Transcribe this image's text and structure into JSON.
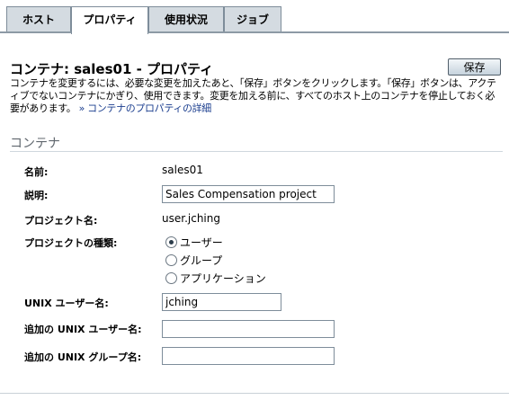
{
  "tabs": [
    {
      "label": "ホスト",
      "active": false
    },
    {
      "label": "プロパティ",
      "active": true
    },
    {
      "label": "使用状況",
      "active": false
    },
    {
      "label": "ジョブ",
      "active": false
    }
  ],
  "page": {
    "title": "コンテナ: sales01 - プロパティ",
    "save_label": "保存",
    "description": "コンテナを変更するには、必要な変更を加えたあと、「保存」ボタンをクリックします。「保存」ボタンは、アクティブでないコンテナにかぎり、使用できます。変更を加える前に、すべてのホスト上のコンテナを停止しておく必要があります。",
    "details_link": "» コンテナのプロパティの詳細"
  },
  "section": {
    "title": "コンテナ"
  },
  "form": {
    "name_label": "名前:",
    "name_value": "sales01",
    "desc_label": "説明:",
    "desc_value": "Sales Compensation project",
    "project_label": "プロジェクト名:",
    "project_value": "user.jching",
    "type_label": "プロジェクトの種類:",
    "type_options": [
      {
        "label": "ユーザー",
        "checked": true
      },
      {
        "label": "グループ",
        "checked": false
      },
      {
        "label": "アプリケーション",
        "checked": false
      }
    ],
    "unix_user_label": "UNIX ユーザー名:",
    "unix_user_value": "jching",
    "extra_user_label": "追加の UNIX ユーザー名:",
    "extra_user_value": "",
    "extra_group_label": "追加の UNIX グループ名:",
    "extra_group_value": ""
  }
}
